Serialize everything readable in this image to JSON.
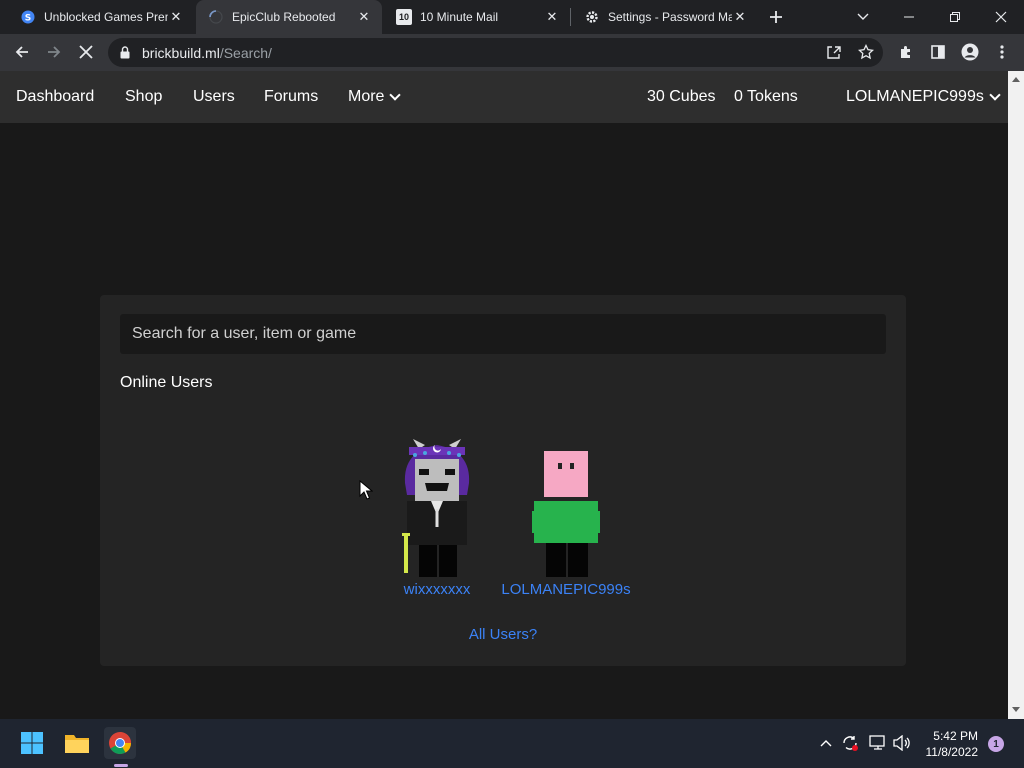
{
  "browser": {
    "tabs": [
      {
        "title": "Unblocked Games Premium",
        "favicon": "globe-icon",
        "active": false
      },
      {
        "title": "EpicClub Rebooted",
        "favicon": "loading-spinner-icon",
        "active": true
      },
      {
        "title": "10 Minute Mail",
        "favicon": "10-minute-mail-icon",
        "favicon_text": "10",
        "active": false
      },
      {
        "title": "Settings - Password Manager",
        "favicon": "gear-icon",
        "active": false
      }
    ],
    "url_host": "brickbuild.ml",
    "url_path": "/Search/"
  },
  "site": {
    "nav": {
      "dashboard": "Dashboard",
      "shop": "Shop",
      "users": "Users",
      "forums": "Forums",
      "more": "More",
      "cubes": "30 Cubes",
      "tokens": "0 Tokens",
      "account": "LOLMANEPIC999s"
    },
    "search": {
      "placeholder": "Search for a user, item or game"
    },
    "online_users_title": "Online Users",
    "online_users": [
      {
        "name": "wixxxxxxx"
      },
      {
        "name": "LOLMANEPIC999s"
      }
    ],
    "all_users_link": "All Users?"
  },
  "taskbar": {
    "time": "5:42 PM",
    "date": "11/8/2022",
    "notification_count": "1"
  },
  "colors": {
    "link": "#3b82f6",
    "nav_bg": "#2e2e2e",
    "page_bg": "#191919",
    "card_bg": "#242424"
  }
}
